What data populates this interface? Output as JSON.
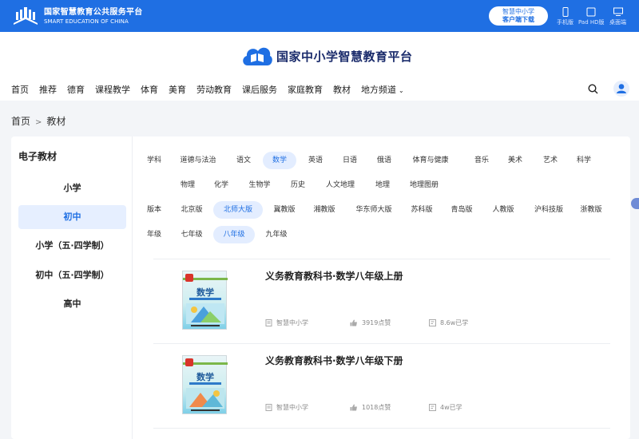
{
  "topbar": {
    "brand_cn": "国家智慧教育公共服务平台",
    "brand_en": "SMART EDUCATION OF CHINA",
    "download_line1": "智慧中小学",
    "download_line2": "客户端下载",
    "devices": [
      {
        "label": "手机版",
        "icon": "mobile-icon"
      },
      {
        "label": "Pad HD版",
        "icon": "tablet-icon"
      },
      {
        "label": "桌面端",
        "icon": "desktop-icon"
      }
    ],
    "bg_color": "#1f6fe3"
  },
  "header": {
    "site_title": "国家中小学智慧教育平台",
    "nav": [
      "首页",
      "推荐",
      "德育",
      "课程教学",
      "体育",
      "美育",
      "劳动教育",
      "课后服务",
      "家庭教育",
      "教材",
      "地方频道"
    ]
  },
  "breadcrumb": [
    "首页",
    "教材"
  ],
  "sidebar": {
    "title": "电子教材",
    "items": [
      "小学",
      "初中",
      "小学（五·四学制）",
      "初中（五·四学制）",
      "高中"
    ],
    "active_index": 1
  },
  "filters": {
    "subjects_row1": [
      "学科",
      "道德与法治",
      "语文",
      "数学",
      "英语",
      "日语",
      "俄语",
      "体育与健康",
      "音乐",
      "美术",
      "艺术",
      "科学"
    ],
    "subjects_row2": [
      "物理",
      "化学",
      "生物学",
      "历史",
      "人文地理",
      "地理",
      "地理图册"
    ],
    "editions": [
      "版本",
      "北京版",
      "北师大版",
      "冀教版",
      "湘教版",
      "华东师大版",
      "苏科版",
      "青岛版",
      "人教版",
      "沪科技版",
      "浙教版"
    ],
    "grades": [
      "年级",
      "七年级",
      "八年级",
      "九年级"
    ],
    "selected_subject": "数学",
    "selected_edition": "北师大版",
    "selected_grade": "八年级"
  },
  "books": [
    {
      "title": "义务教育教科书·数学八年级上册",
      "cover_title": "数学",
      "source": "智慧中小学",
      "likes": "3919点赞",
      "learners": "8.6w已学"
    },
    {
      "title": "义务教育教科书·数学八年级下册",
      "cover_title": "数学",
      "source": "智慧中小学",
      "likes": "1018点赞",
      "learners": "4w已学"
    }
  ],
  "accent_color": "#1f6fe3"
}
